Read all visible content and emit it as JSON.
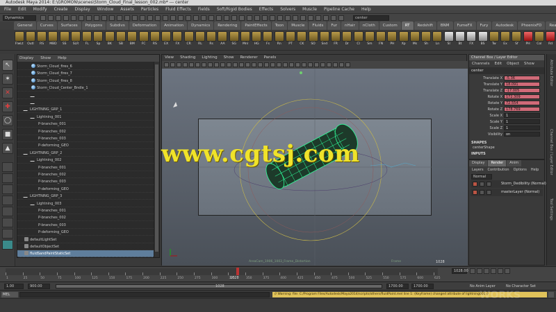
{
  "window": {
    "title": "Autodesk Maya 2014: E:\\GROMON\\scenes\\Storm_Cloud_Final_lesson_002.mb* --- center"
  },
  "menubar": {
    "items": [
      "File",
      "Edit",
      "Modify",
      "Create",
      "Display",
      "Window",
      "Assets",
      "Particles",
      "Fluid Effects",
      "Fields",
      "Soft/Rigid Bodies",
      "Effects",
      "Solvers",
      "Muscle",
      "Pipeline Cache",
      "Help"
    ]
  },
  "statusline": {
    "menuset": "Dynamics",
    "search_value": "center"
  },
  "shelf": {
    "tabs": [
      "General",
      "Curves",
      "Surfaces",
      "Polygons",
      "Subdivs",
      "Deformation",
      "Animation",
      "Dynamics",
      "Rendering",
      "PaintEffects",
      "Toon",
      "Muscle",
      "Fluids",
      "Fur",
      "nHair",
      "nCloth",
      "Custom",
      "RT",
      "Redshift",
      "BNM",
      "FumeFX",
      "Fury",
      "Autodesk",
      "PhoenixFD",
      "RealFlow"
    ],
    "active_tab": "RT",
    "buttons": [
      "FlwLt",
      "Outl",
      "RS",
      "MBD",
      "SS",
      "SLR",
      "FL",
      "Sp",
      "BK",
      "SB",
      "BM",
      "FC",
      "RS",
      "EX",
      "FX",
      "CR",
      "RL",
      "Rs",
      "AA",
      "SG",
      "Mnl",
      "HG",
      "Fs",
      "Rn",
      "PT",
      "CK",
      "SO",
      "Snd",
      "FR",
      "Dr",
      "Cl",
      "Sm",
      "FN",
      "PH",
      "Xp",
      "Ms",
      "Sh",
      "Ln",
      "Sl",
      "Bt",
      "FX",
      "BS",
      "Tw",
      "Ex",
      "Sf",
      "PH",
      "Col",
      "Rd"
    ]
  },
  "outliner": {
    "menu": [
      "Display",
      "Show",
      "Help"
    ],
    "rows": [
      {
        "label": "Storm_Cloud_fires_6",
        "indent": 1,
        "icon": "sphere"
      },
      {
        "label": "Storm_Cloud_fires_7",
        "indent": 1,
        "icon": "sphere"
      },
      {
        "label": "Storm_Cloud_fires_8",
        "indent": 1,
        "icon": "sphere"
      },
      {
        "label": "Storm_Cloud_Center_Bndle_1",
        "indent": 1,
        "icon": "sphere"
      },
      {
        "label": "",
        "indent": 1,
        "icon": "curve"
      },
      {
        "label": "",
        "indent": 1,
        "icon": "curve"
      },
      {
        "label": "LIGHTNING_GRP_1",
        "indent": 0,
        "icon": "curve"
      },
      {
        "label": "Lightning_001",
        "indent": 1,
        "icon": "curve"
      },
      {
        "label": "P-branches_001",
        "indent": 2,
        "icon": "none"
      },
      {
        "label": "P-branches_002",
        "indent": 2,
        "icon": "none"
      },
      {
        "label": "P-branches_003",
        "indent": 2,
        "icon": "none"
      },
      {
        "label": "P-deforming_GEO",
        "indent": 2,
        "icon": "none"
      },
      {
        "label": "LIGHTNING_GRP_2",
        "indent": 0,
        "icon": "curve"
      },
      {
        "label": "Lightning_002",
        "indent": 1,
        "icon": "curve"
      },
      {
        "label": "P-branches_001",
        "indent": 2,
        "icon": "none"
      },
      {
        "label": "P-branches_002",
        "indent": 2,
        "icon": "none"
      },
      {
        "label": "P-branches_003",
        "indent": 2,
        "icon": "none"
      },
      {
        "label": "P-deforming_GEO",
        "indent": 2,
        "icon": "none"
      },
      {
        "label": "LIGHTNING_GRP_3",
        "indent": 0,
        "icon": "curve"
      },
      {
        "label": "Lightning_003",
        "indent": 1,
        "icon": "curve"
      },
      {
        "label": "P-branches_001",
        "indent": 2,
        "icon": "none"
      },
      {
        "label": "P-branches_002",
        "indent": 2,
        "icon": "none"
      },
      {
        "label": "P-branches_003",
        "indent": 2,
        "icon": "none"
      },
      {
        "label": "P-deforming_GEO",
        "indent": 2,
        "icon": "none"
      },
      {
        "label": "defaultLightSet",
        "indent": 0,
        "icon": "set"
      },
      {
        "label": "defaultObjectSet",
        "indent": 0,
        "icon": "set"
      },
      {
        "label": "fluidSandPaintStaticSet",
        "indent": 0,
        "icon": "set",
        "selected": true
      }
    ]
  },
  "viewport": {
    "menu": [
      "View",
      "Shading",
      "Lighting",
      "Show",
      "Renderer",
      "Panels"
    ],
    "top_label": "",
    "bottom_label": "AreaCam_1906_1003_Frame_Distortion",
    "camera_label": "Frame",
    "frame_number": "1028"
  },
  "watermark": {
    "text": "www.cgtsj.com",
    "corner_text": "WORKS"
  },
  "channelbox": {
    "title": "Channel Box / Layer Editor",
    "menu": [
      "Channels",
      "Edit",
      "Object",
      "Show"
    ],
    "object": "center",
    "attributes": [
      {
        "name": "Translate X",
        "value": "-5.36",
        "keyed": true
      },
      {
        "name": "Translate Y",
        "value": "18.091",
        "keyed": true
      },
      {
        "name": "Translate Z",
        "value": "-17.005",
        "keyed": true
      },
      {
        "name": "Rotate X",
        "value": "172.309",
        "keyed": true
      },
      {
        "name": "Rotate Y",
        "value": "72.554",
        "keyed": true
      },
      {
        "name": "Rotate Z",
        "value": "178.769",
        "keyed": true
      },
      {
        "name": "Scale X",
        "value": "1",
        "keyed": false
      },
      {
        "name": "Scale Y",
        "value": "1",
        "keyed": false
      },
      {
        "name": "Scale Z",
        "value": "1",
        "keyed": false
      },
      {
        "name": "Visibility",
        "value": "on",
        "keyed": false
      }
    ],
    "shapes_header": "SHAPES",
    "shape_name": "centerShape",
    "inputs_header": "INPUTS"
  },
  "layereditor": {
    "tabs": [
      "Display",
      "Render",
      "Anim"
    ],
    "active_tab": "Render",
    "menu": [
      "Layers",
      "Contribution",
      "Options",
      "Help"
    ],
    "mode": "Normal",
    "layers": [
      "Storm_Dedibility (Normal)",
      "masterLayer (Normal)"
    ]
  },
  "rightstrip": {
    "labels": [
      "Attribute Editor",
      "Channel Box / Layer Editor",
      "Tool Settings"
    ]
  },
  "timeline": {
    "ticks": [
      "1",
      "25",
      "50",
      "75",
      "100",
      "125",
      "150",
      "175",
      "200",
      "225",
      "250",
      "275",
      "300",
      "325",
      "350",
      "375",
      "400",
      "425",
      "450",
      "475",
      "500",
      "525",
      "550",
      "575",
      "600",
      "625"
    ],
    "current": "1028",
    "current_frame_field": "1028.00"
  },
  "rangebar": {
    "start": "1.00",
    "inner_start": "900.00",
    "range_label": "1028",
    "end_inner": "1700.00",
    "end": "1700.00",
    "anim_layer": "No Anim Layer",
    "char_set": "No Character Set"
  },
  "cmdline": {
    "mel_label": "MEL",
    "result": "// Warning: file: C:/Program Files/Autodesk/Maya2014/scripts/others/fluidPaint.mel line 1: (Keyframe) changed attribute of lightning001 //"
  },
  "helpline": {
    "text": ""
  }
}
